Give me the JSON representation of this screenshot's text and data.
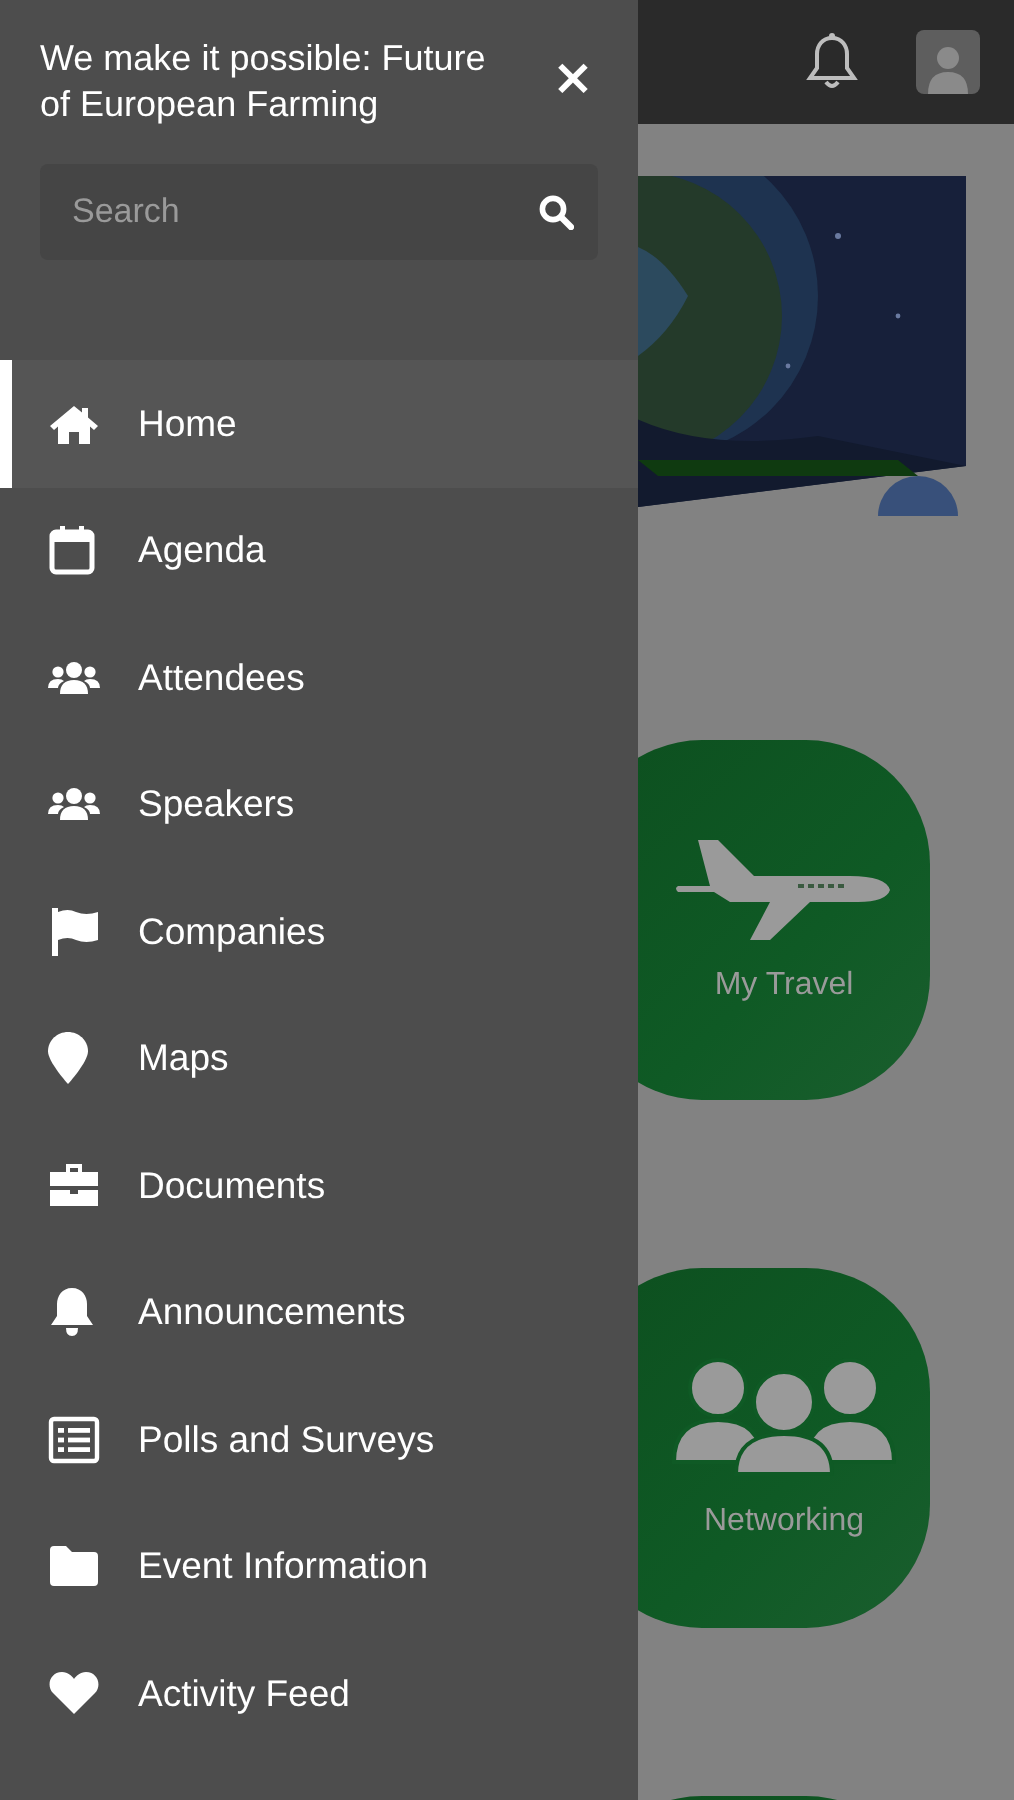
{
  "drawer": {
    "title": "We make it possible: Future of European Farming",
    "close": "×",
    "search": {
      "placeholder": "Search"
    },
    "items": [
      {
        "label": "Home",
        "selected": true
      },
      {
        "label": "Agenda",
        "selected": false
      },
      {
        "label": "Attendees",
        "selected": false
      },
      {
        "label": "Speakers",
        "selected": false
      },
      {
        "label": "Companies",
        "selected": false
      },
      {
        "label": "Maps",
        "selected": false
      },
      {
        "label": "Documents",
        "selected": false
      },
      {
        "label": "Announcements",
        "selected": false
      },
      {
        "label": "Polls and Surveys",
        "selected": false
      },
      {
        "label": "Event Information",
        "selected": false
      },
      {
        "label": "Activity Feed",
        "selected": false
      }
    ]
  },
  "home": {
    "tiles": [
      {
        "kind": "labeled",
        "label": "My Travel"
      },
      {
        "kind": "labeled",
        "label": "Networking"
      },
      {
        "kind": "partial"
      }
    ]
  }
}
